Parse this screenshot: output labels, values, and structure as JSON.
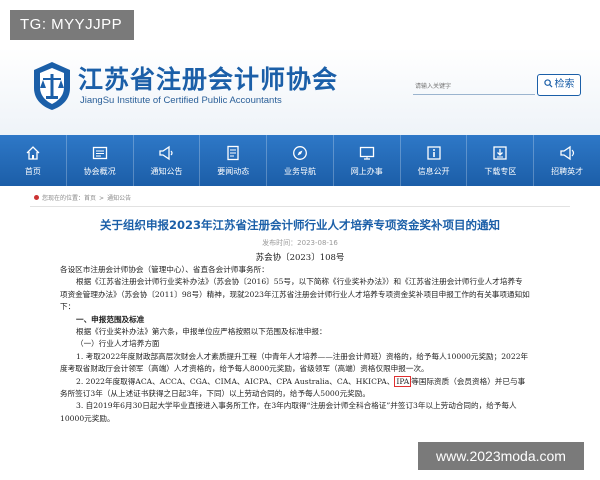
{
  "overlay_tag": "TG: MYYJJPP",
  "header": {
    "title": "江苏省注册会计师协会",
    "subtitle": "JiangSu Institute of Certified Public Accountants",
    "search_placeholder": "请输入关键字",
    "search_button": "检索"
  },
  "nav": {
    "items": [
      {
        "label": "首页",
        "icon": "home-icon"
      },
      {
        "label": "协会概况",
        "icon": "grid-icon"
      },
      {
        "label": "通知公告",
        "icon": "megaphone-icon"
      },
      {
        "label": "要闻动态",
        "icon": "document-icon"
      },
      {
        "label": "业务导航",
        "icon": "compass-icon"
      },
      {
        "label": "网上办事",
        "icon": "monitor-icon"
      },
      {
        "label": "信息公开",
        "icon": "info-icon"
      },
      {
        "label": "下载专区",
        "icon": "download-icon"
      },
      {
        "label": "招聘英才",
        "icon": "bullhorn-icon"
      }
    ]
  },
  "breadcrumb": {
    "prefix": "您现在的位置：",
    "home": "首页",
    "sep": ">",
    "current": "通知公告"
  },
  "article": {
    "title": "关于组织申报2023年江苏省注册会计师行业人才培养专项资金奖补项目的通知",
    "date": "发布时间：2023-08-16",
    "doc_no": "苏会协〔2023〕108号",
    "paragraphs": {
      "p1": "各设区市注册会计师协会（管理中心）、省直各会计师事务所：",
      "p2": "根据《江苏省注册会计师行业奖补办法》（苏会协〔2016〕55号，以下简称《行业奖补办法》）和《江苏省注册会计师行业人才培养专项资金管理办法》（苏会协〔2011〕98号）精神，现就2023年江苏省注册会计师行业人才培养专项资金奖补项目申报工作的有关事项通知如下：",
      "h1": "一、申报范围及标准",
      "p3": "根据《行业奖补办法》第六条，申报单位应严格按照以下范围及标准申报：",
      "h2": "（一）行业人才培养方面",
      "p4": "1. 考取2022年度财政部高层次财会人才素质提升工程（中青年人才培养——注册会计师班）资格的，给予每人10000元奖励；2022年度考取省财政厅会计领军（高端）人才资格的，给予每人8000元奖励，省级领军（高端）资格仅限申报一次。",
      "p5a": "2. 2022年度取得ACA、ACCA、CGA、CIMA、AICPA、CPA Australia、CA、HKICPA、",
      "p5_ipa": "IPA",
      "p5b": "等国际资质（会员资格）并已与事务所签订3年（从上述证书获得之日起3年，下同）以上劳动合同的，给予每人5000元奖励。",
      "p6": "3. 自2019年6月30日起大学毕业直接进入事务所工作，在3年内取得“注册会计师全科合格证”并签订3年以上劳动合同的，给予每人10000元奖励。"
    }
  },
  "watermark": "www.2023moda.com",
  "colors": {
    "brand_blue": "#1b5fa8",
    "nav_blue": "#2e78c7",
    "highlight_red": "#e03030"
  }
}
